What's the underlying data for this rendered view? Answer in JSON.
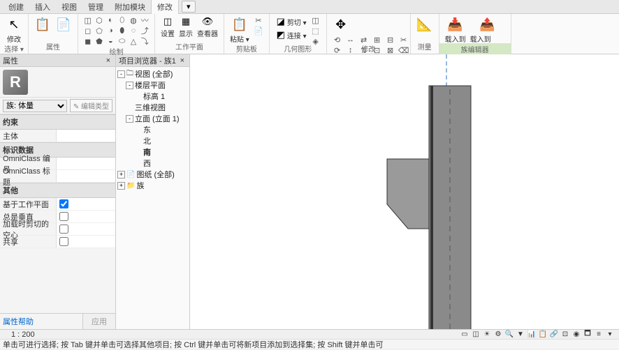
{
  "menubar": {
    "tabs": [
      "创建",
      "插入",
      "视图",
      "管理",
      "附加模块",
      "修改"
    ],
    "active": 5,
    "plus": "▾"
  },
  "ribbon": {
    "groups": [
      {
        "label": "选择 ▾",
        "items": [
          {
            "icon": "↖",
            "label": "修改"
          }
        ]
      },
      {
        "label": "属性",
        "items": [
          {
            "icon": "📋",
            "label": ""
          },
          {
            "icon": "📄",
            "label": ""
          }
        ]
      },
      {
        "label": "绘制",
        "mini_rows": [
          [
            "◫",
            "⬡",
            "◐",
            "⬯",
            "◍",
            "〰"
          ],
          [
            "◻",
            "⬠",
            "◑",
            "⬮",
            "◌",
            "⤴"
          ],
          [
            "◼",
            "⬟",
            "◒",
            "⬭",
            "△",
            "⤵"
          ]
        ]
      },
      {
        "label": "工作平面",
        "items": [
          {
            "icon": "◫",
            "label": "设置"
          },
          {
            "icon": "▦",
            "label": "显示"
          },
          {
            "icon": "👁",
            "label": "查看器"
          }
        ]
      },
      {
        "label": "剪贴板",
        "items": [
          {
            "icon": "📋",
            "label": "粘贴 ▾"
          }
        ],
        "mini": [
          "✂",
          "📄"
        ]
      },
      {
        "label": "几何图形",
        "items": [
          {
            "icon": "◪",
            "label": "剪切 ▾"
          },
          {
            "icon": "◩",
            "label": "连接 ▾"
          }
        ],
        "mini": [
          "◫",
          "⬚",
          "◈"
        ]
      },
      {
        "label": "修改",
        "items": [
          {
            "icon": "✥",
            "label": ""
          }
        ],
        "mini_rows": [
          [
            "⟲",
            "↔",
            "⇄",
            "⊞",
            "⊟",
            "✂"
          ],
          [
            "⟳",
            "↕",
            "⇅",
            "⊡",
            "⊠",
            "⌫"
          ],
          [
            "↯",
            "⤡",
            "⤢",
            "□",
            "▭",
            "◫"
          ]
        ]
      },
      {
        "label": "测量",
        "items": [
          {
            "icon": "📐",
            "label": ""
          }
        ]
      },
      {
        "label": "族编辑器",
        "items": [
          {
            "icon": "📥",
            "label": "载入到\n项目"
          },
          {
            "icon": "📤",
            "label": "载入到\n项目并关闭"
          }
        ],
        "hl": true
      }
    ]
  },
  "props": {
    "title": "属性",
    "family_type": "族: 体量",
    "edit_type": "✎ 编辑类型",
    "sections": [
      {
        "name": "约束",
        "rows": [
          {
            "k": "主体",
            "v": ""
          }
        ]
      },
      {
        "name": "标识数据",
        "rows": [
          {
            "k": "OmniClass 编号",
            "v": "",
            "input": true
          },
          {
            "k": "OmniClass 标题",
            "v": ""
          }
        ]
      },
      {
        "name": "其他",
        "rows": [
          {
            "k": "基于工作平面",
            "cb": true
          },
          {
            "k": "总是垂直",
            "cb": false
          },
          {
            "k": "加载时剪切的空心",
            "cb": false
          },
          {
            "k": "共享",
            "cb": false
          }
        ]
      }
    ],
    "help": "属性帮助",
    "apply": "应用"
  },
  "browser": {
    "title": "项目浏览器 - 族1",
    "nodes": [
      {
        "exp": "-",
        "lbl": "视图 (全部)",
        "indent": 0,
        "icon": "🗀"
      },
      {
        "exp": "-",
        "lbl": "楼层平面",
        "indent": 1
      },
      {
        "lbl": "标高 1",
        "indent": 2
      },
      {
        "lbl": "三维视图",
        "indent": 1
      },
      {
        "exp": "-",
        "lbl": "立面 (立面 1)",
        "indent": 1
      },
      {
        "lbl": "东",
        "indent": 2
      },
      {
        "lbl": "北",
        "indent": 2
      },
      {
        "lbl": "南",
        "indent": 2,
        "bold": true
      },
      {
        "lbl": "西",
        "indent": 2
      },
      {
        "exp": "+",
        "lbl": "图纸 (全部)",
        "indent": 0,
        "icon": "📄"
      },
      {
        "exp": "+",
        "lbl": "族",
        "indent": 0,
        "icon": "📁"
      }
    ]
  },
  "status": {
    "scale": "1 : 200",
    "icons": [
      "▭",
      "◫",
      "☀",
      "⚙",
      "🔍",
      "▼",
      "📊",
      "📋",
      "🔗",
      "⊡",
      "◉",
      "🗖",
      "≡",
      "▾"
    ]
  },
  "hint": "单击可进行选择; 按 Tab 键并单击可选择其他项目; 按 Ctrl 键并单击可将新项目添加到选择集; 按 Shift 键并单击可",
  "colors": {
    "pillar": "#8a8a8a",
    "wedge": "#9a9a9a",
    "axis_top": "#2c72c7"
  }
}
